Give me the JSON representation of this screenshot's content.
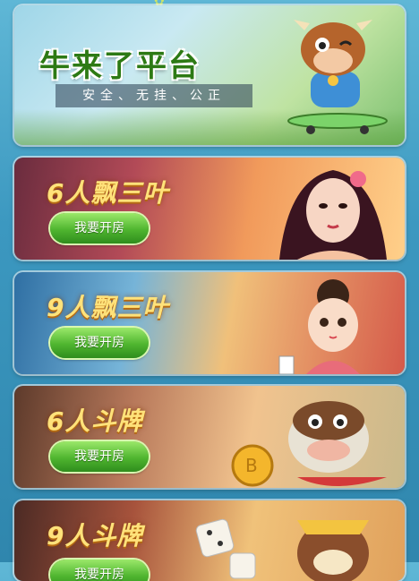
{
  "banner": {
    "title": "牛来了平台",
    "tagline": "安全、无挂、公正"
  },
  "rooms": [
    {
      "title": "6人飘三叶",
      "button": "我要开房"
    },
    {
      "title": "9人飘三叶",
      "button": "我要开房"
    },
    {
      "title": "6人斗牌",
      "button": "我要开房"
    },
    {
      "title": "9人斗牌",
      "button": "我要开房"
    }
  ]
}
